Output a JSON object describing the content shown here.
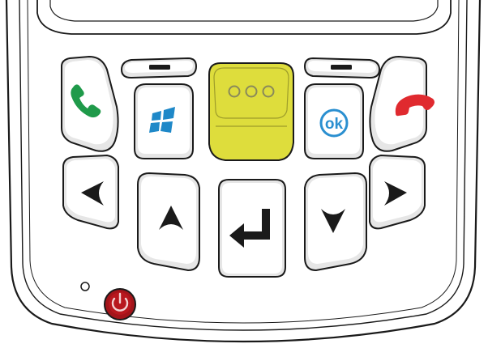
{
  "device": {
    "name": "handheld-keypad",
    "body_color": "#ffffff",
    "outline_color": "#1a1a1a",
    "key_face_color": "#ffffff",
    "key_shade_color": "#e6e6e6",
    "accent_colors": {
      "scan_key": "#dedd3c",
      "scan_key_dots": "#8a8a5a",
      "call_green": "#1f9a4a",
      "end_red": "#e02a2f",
      "windows_blue": "#1e88c8",
      "ok_blue": "#2a8fd0",
      "power_red": "#a3141a",
      "glyph_dark": "#1a1a1a"
    }
  },
  "keys": [
    {
      "id": "call",
      "icon": "phone-call-icon"
    },
    {
      "id": "left-soft",
      "icon": "minus-bar-icon"
    },
    {
      "id": "scan",
      "icon": "scan-dots-icon"
    },
    {
      "id": "right-soft",
      "icon": "minus-bar-icon"
    },
    {
      "id": "end-call",
      "icon": "phone-end-icon"
    },
    {
      "id": "windows",
      "icon": "windows-logo-icon"
    },
    {
      "id": "ok",
      "icon": "ok-circle-icon",
      "label": "ok"
    },
    {
      "id": "left",
      "icon": "chevron-left-icon"
    },
    {
      "id": "up",
      "icon": "chevron-up-icon"
    },
    {
      "id": "enter",
      "icon": "enter-return-icon"
    },
    {
      "id": "down",
      "icon": "chevron-down-icon"
    },
    {
      "id": "right",
      "icon": "chevron-right-icon"
    },
    {
      "id": "power",
      "icon": "power-icon"
    },
    {
      "id": "indicator",
      "icon": "led-indicator-icon"
    }
  ]
}
